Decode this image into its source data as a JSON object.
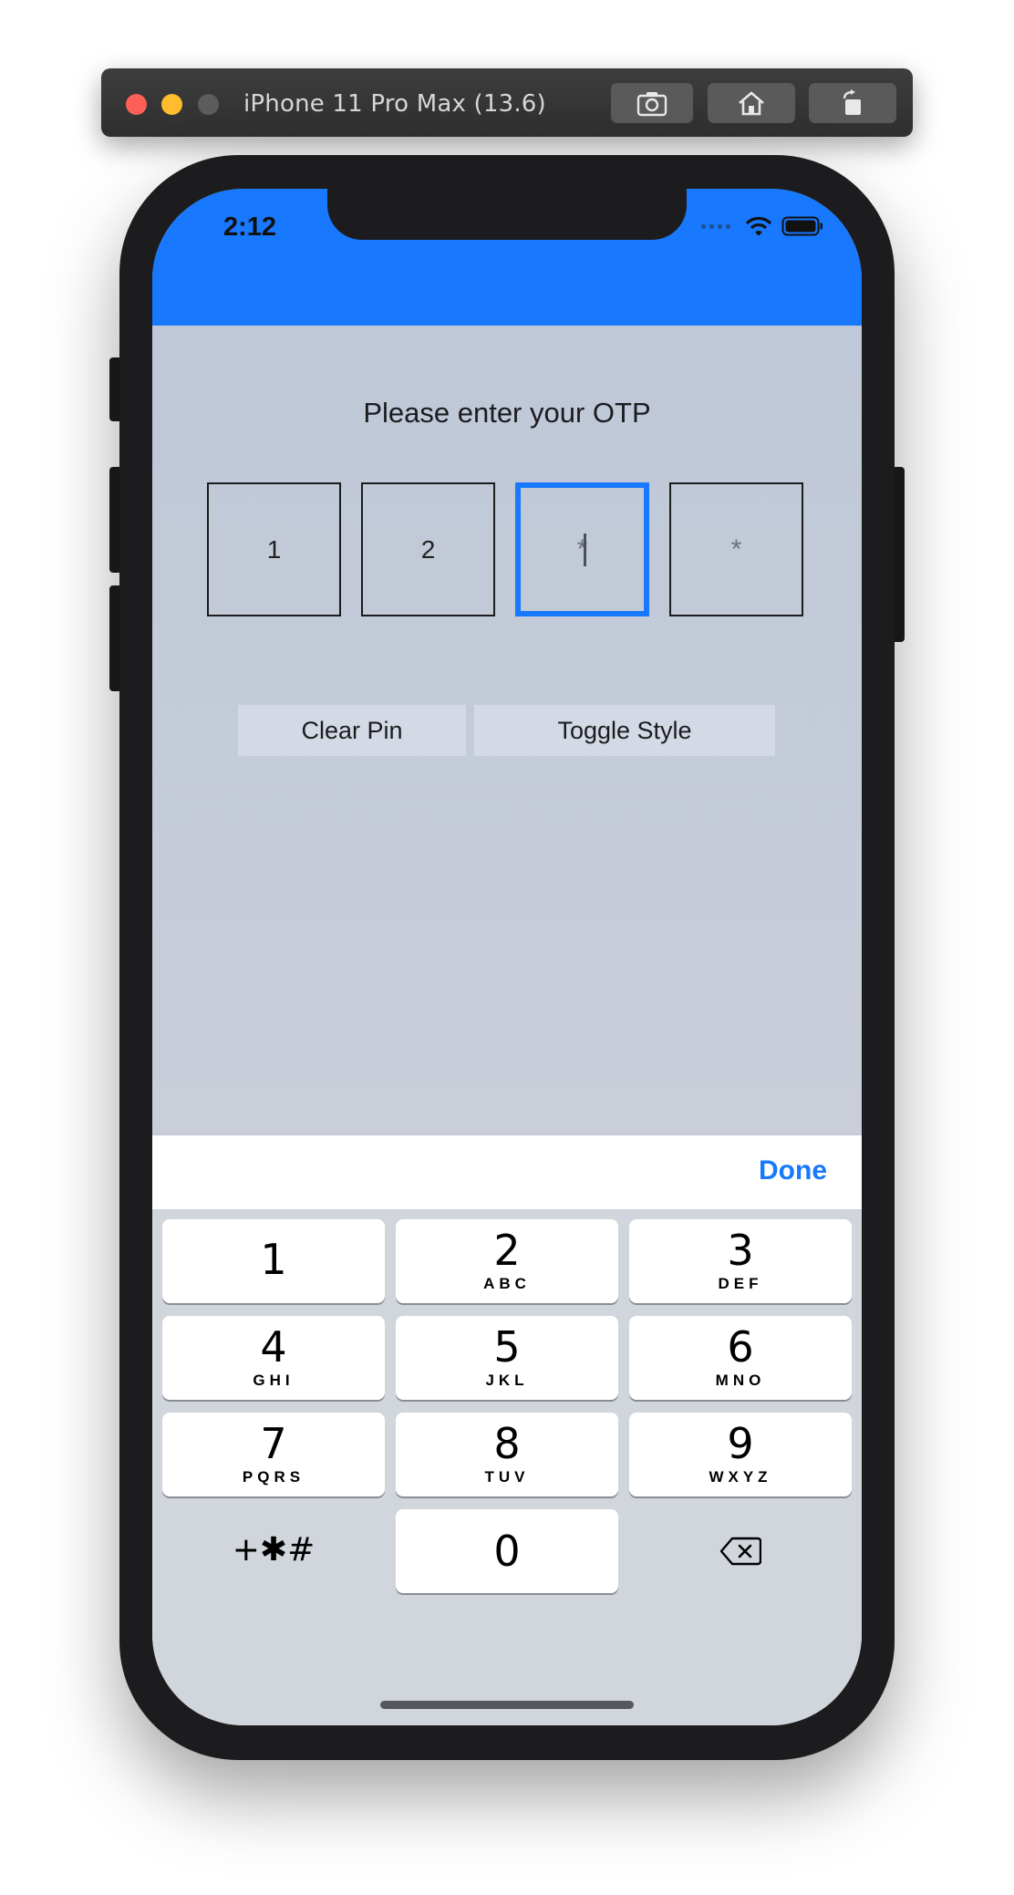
{
  "window": {
    "title": "iPhone 11 Pro Max (13.6)",
    "buttons": [
      "screenshot-icon",
      "home-icon",
      "rotate-icon"
    ]
  },
  "status_bar": {
    "time": "2:12"
  },
  "colors": {
    "accent": "#1878fe",
    "header": "#1878fe"
  },
  "otp": {
    "prompt": "Please enter your OTP",
    "boxes": [
      {
        "value": "1",
        "placeholder": ""
      },
      {
        "value": "2",
        "placeholder": ""
      },
      {
        "value": "",
        "placeholder": "*"
      },
      {
        "value": "",
        "placeholder": "*"
      }
    ],
    "active_index": 2
  },
  "actions": {
    "clear_label": "Clear Pin",
    "toggle_label": "Toggle Style"
  },
  "toolbar": {
    "done_label": "Done"
  },
  "keypad": {
    "keys": [
      {
        "digit": "1",
        "letters": ""
      },
      {
        "digit": "2",
        "letters": "ABC"
      },
      {
        "digit": "3",
        "letters": "DEF"
      },
      {
        "digit": "4",
        "letters": "GHI"
      },
      {
        "digit": "5",
        "letters": "JKL"
      },
      {
        "digit": "6",
        "letters": "MNO"
      },
      {
        "digit": "7",
        "letters": "PQRS"
      },
      {
        "digit": "8",
        "letters": "TUV"
      },
      {
        "digit": "9",
        "letters": "WXYZ"
      },
      {
        "digit": "0",
        "letters": ""
      }
    ],
    "symbols_label": "+✱#",
    "delete_icon": "backspace-icon"
  }
}
